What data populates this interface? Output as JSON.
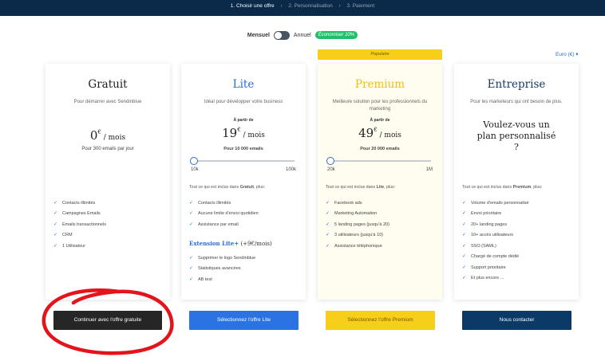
{
  "steps": {
    "step1": "1. Choisir une offre",
    "sep1": "›",
    "step2": "2. Personnalisation",
    "sep2": "›",
    "step3": "3. Paiement"
  },
  "billing": {
    "monthly": "Mensuel",
    "annual": "Annuel",
    "save_badge": "Économiser 10%"
  },
  "currency_select": "Euro (€) ▾",
  "popular_label": "Populaire",
  "plans": [
    {
      "name": "Gratuit",
      "subtitle": "Pour démarrer avec Sendinblue",
      "price": "0",
      "currency": "€",
      "per": " / mois",
      "emails": "Pour 300 emails par jour",
      "features": [
        "Contacts illimités",
        "Campagnes Emails",
        "Emails transactionnels",
        "CRM",
        "1 Utilisateur"
      ],
      "button": "Continuer avec l'offre gratuite"
    },
    {
      "name": "Lite",
      "subtitle": "Idéal pour développer votre business",
      "from": "À partir de",
      "price": "19",
      "currency": "€",
      "per": " / mois",
      "emails": "Pour 10 000 emails",
      "slider_min": "10k",
      "slider_max": "100k",
      "slider_level": 0,
      "included_prefix": "Tout ce qui est inclus dans ",
      "included_plan": "Gratuit",
      "included_suffix": ", plus:",
      "features": [
        "Contacts illimités",
        "Aucune limite d'envoi quotidien",
        "Assistance par email"
      ],
      "extension_title": "Extension Lite+",
      "extension_price": " (+9€/mois)",
      "extension_features": [
        "Supprimer le logo Sendinblue",
        "Statistiques avancées",
        "AB test"
      ],
      "button": "Sélectionnez l'offre Lite"
    },
    {
      "name": "Premium",
      "subtitle": "Meilleure solution pour les professionnels du marketing",
      "from": "À partir de",
      "price": "49",
      "currency": "€",
      "per": " / mois",
      "emails": "Pour 20 000 emails",
      "slider_min": "20k",
      "slider_max": "1M",
      "slider_level": 0,
      "included_prefix": "Tout ce qui est inclus dans ",
      "included_plan": "Lite",
      "included_suffix": ", plus:",
      "features": [
        "Facebook ads",
        "Marketing Automation",
        "5 landing pages (jusqu'à 20)",
        "3 utilisateurs (jusqu'à 10)",
        "Assistance téléphonique"
      ],
      "button": "Sélectionnez l'offre Premium"
    },
    {
      "name": "Entreprise",
      "subtitle": "Pour les marketeurs qui ont besoin de plus.",
      "custom_line1": "Voulez-vous un",
      "custom_line2": "plan personnalisé",
      "custom_line3": "?",
      "included_prefix": "Tout ce qui est inclus dans ",
      "included_plan": "Premium",
      "included_suffix": ", plus:",
      "features": [
        "Volume d'emails personnalisé",
        "Envoi prioritaire",
        "20+ landing pages",
        "10+ accès utilisateurs",
        "SSO (SAML)",
        "Chargé de compte dédié",
        "Support prioritaire",
        "Et plus encore ..."
      ],
      "button": "Nous contacter"
    }
  ],
  "colors": {
    "header": "#0b2a4a",
    "lite_blue": "#2b73e3",
    "premium_yellow": "#f7cf1a",
    "enterprise_navy": "#0b3a66",
    "free_button": "#262626",
    "annotation_red": "#e3141b"
  },
  "icons": {
    "check": "check-icon",
    "slider_handle": "slider-thumb"
  }
}
